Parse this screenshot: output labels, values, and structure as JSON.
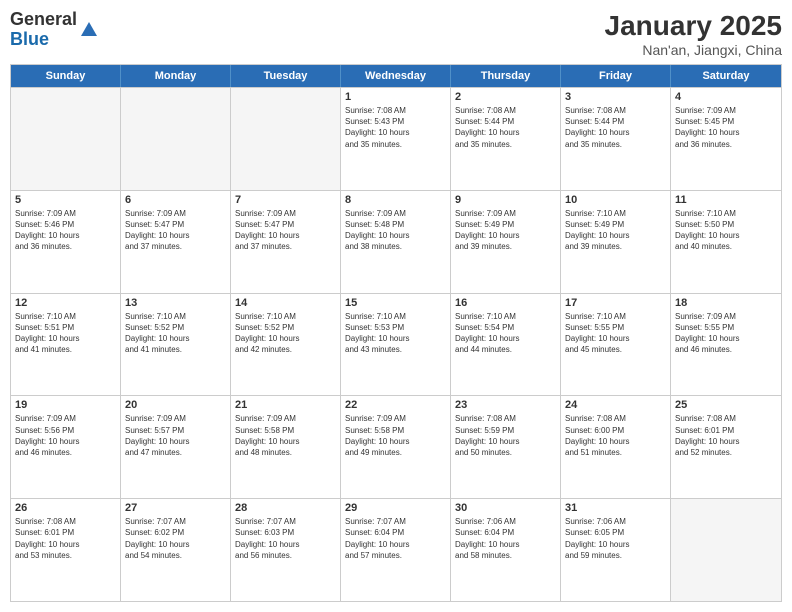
{
  "header": {
    "logo_general": "General",
    "logo_blue": "Blue",
    "title": "January 2025",
    "subtitle": "Nan'an, Jiangxi, China"
  },
  "weekdays": [
    "Sunday",
    "Monday",
    "Tuesday",
    "Wednesday",
    "Thursday",
    "Friday",
    "Saturday"
  ],
  "weeks": [
    [
      {
        "num": "",
        "info": "",
        "empty": true
      },
      {
        "num": "",
        "info": "",
        "empty": true
      },
      {
        "num": "",
        "info": "",
        "empty": true
      },
      {
        "num": "1",
        "info": "Sunrise: 7:08 AM\nSunset: 5:43 PM\nDaylight: 10 hours\nand 35 minutes."
      },
      {
        "num": "2",
        "info": "Sunrise: 7:08 AM\nSunset: 5:44 PM\nDaylight: 10 hours\nand 35 minutes."
      },
      {
        "num": "3",
        "info": "Sunrise: 7:08 AM\nSunset: 5:44 PM\nDaylight: 10 hours\nand 35 minutes."
      },
      {
        "num": "4",
        "info": "Sunrise: 7:09 AM\nSunset: 5:45 PM\nDaylight: 10 hours\nand 36 minutes."
      }
    ],
    [
      {
        "num": "5",
        "info": "Sunrise: 7:09 AM\nSunset: 5:46 PM\nDaylight: 10 hours\nand 36 minutes."
      },
      {
        "num": "6",
        "info": "Sunrise: 7:09 AM\nSunset: 5:47 PM\nDaylight: 10 hours\nand 37 minutes."
      },
      {
        "num": "7",
        "info": "Sunrise: 7:09 AM\nSunset: 5:47 PM\nDaylight: 10 hours\nand 37 minutes."
      },
      {
        "num": "8",
        "info": "Sunrise: 7:09 AM\nSunset: 5:48 PM\nDaylight: 10 hours\nand 38 minutes."
      },
      {
        "num": "9",
        "info": "Sunrise: 7:09 AM\nSunset: 5:49 PM\nDaylight: 10 hours\nand 39 minutes."
      },
      {
        "num": "10",
        "info": "Sunrise: 7:10 AM\nSunset: 5:49 PM\nDaylight: 10 hours\nand 39 minutes."
      },
      {
        "num": "11",
        "info": "Sunrise: 7:10 AM\nSunset: 5:50 PM\nDaylight: 10 hours\nand 40 minutes."
      }
    ],
    [
      {
        "num": "12",
        "info": "Sunrise: 7:10 AM\nSunset: 5:51 PM\nDaylight: 10 hours\nand 41 minutes."
      },
      {
        "num": "13",
        "info": "Sunrise: 7:10 AM\nSunset: 5:52 PM\nDaylight: 10 hours\nand 41 minutes."
      },
      {
        "num": "14",
        "info": "Sunrise: 7:10 AM\nSunset: 5:52 PM\nDaylight: 10 hours\nand 42 minutes."
      },
      {
        "num": "15",
        "info": "Sunrise: 7:10 AM\nSunset: 5:53 PM\nDaylight: 10 hours\nand 43 minutes."
      },
      {
        "num": "16",
        "info": "Sunrise: 7:10 AM\nSunset: 5:54 PM\nDaylight: 10 hours\nand 44 minutes."
      },
      {
        "num": "17",
        "info": "Sunrise: 7:10 AM\nSunset: 5:55 PM\nDaylight: 10 hours\nand 45 minutes."
      },
      {
        "num": "18",
        "info": "Sunrise: 7:09 AM\nSunset: 5:55 PM\nDaylight: 10 hours\nand 46 minutes."
      }
    ],
    [
      {
        "num": "19",
        "info": "Sunrise: 7:09 AM\nSunset: 5:56 PM\nDaylight: 10 hours\nand 46 minutes."
      },
      {
        "num": "20",
        "info": "Sunrise: 7:09 AM\nSunset: 5:57 PM\nDaylight: 10 hours\nand 47 minutes."
      },
      {
        "num": "21",
        "info": "Sunrise: 7:09 AM\nSunset: 5:58 PM\nDaylight: 10 hours\nand 48 minutes."
      },
      {
        "num": "22",
        "info": "Sunrise: 7:09 AM\nSunset: 5:58 PM\nDaylight: 10 hours\nand 49 minutes."
      },
      {
        "num": "23",
        "info": "Sunrise: 7:08 AM\nSunset: 5:59 PM\nDaylight: 10 hours\nand 50 minutes."
      },
      {
        "num": "24",
        "info": "Sunrise: 7:08 AM\nSunset: 6:00 PM\nDaylight: 10 hours\nand 51 minutes."
      },
      {
        "num": "25",
        "info": "Sunrise: 7:08 AM\nSunset: 6:01 PM\nDaylight: 10 hours\nand 52 minutes."
      }
    ],
    [
      {
        "num": "26",
        "info": "Sunrise: 7:08 AM\nSunset: 6:01 PM\nDaylight: 10 hours\nand 53 minutes."
      },
      {
        "num": "27",
        "info": "Sunrise: 7:07 AM\nSunset: 6:02 PM\nDaylight: 10 hours\nand 54 minutes."
      },
      {
        "num": "28",
        "info": "Sunrise: 7:07 AM\nSunset: 6:03 PM\nDaylight: 10 hours\nand 56 minutes."
      },
      {
        "num": "29",
        "info": "Sunrise: 7:07 AM\nSunset: 6:04 PM\nDaylight: 10 hours\nand 57 minutes."
      },
      {
        "num": "30",
        "info": "Sunrise: 7:06 AM\nSunset: 6:04 PM\nDaylight: 10 hours\nand 58 minutes."
      },
      {
        "num": "31",
        "info": "Sunrise: 7:06 AM\nSunset: 6:05 PM\nDaylight: 10 hours\nand 59 minutes."
      },
      {
        "num": "",
        "info": "",
        "empty": true
      }
    ]
  ]
}
